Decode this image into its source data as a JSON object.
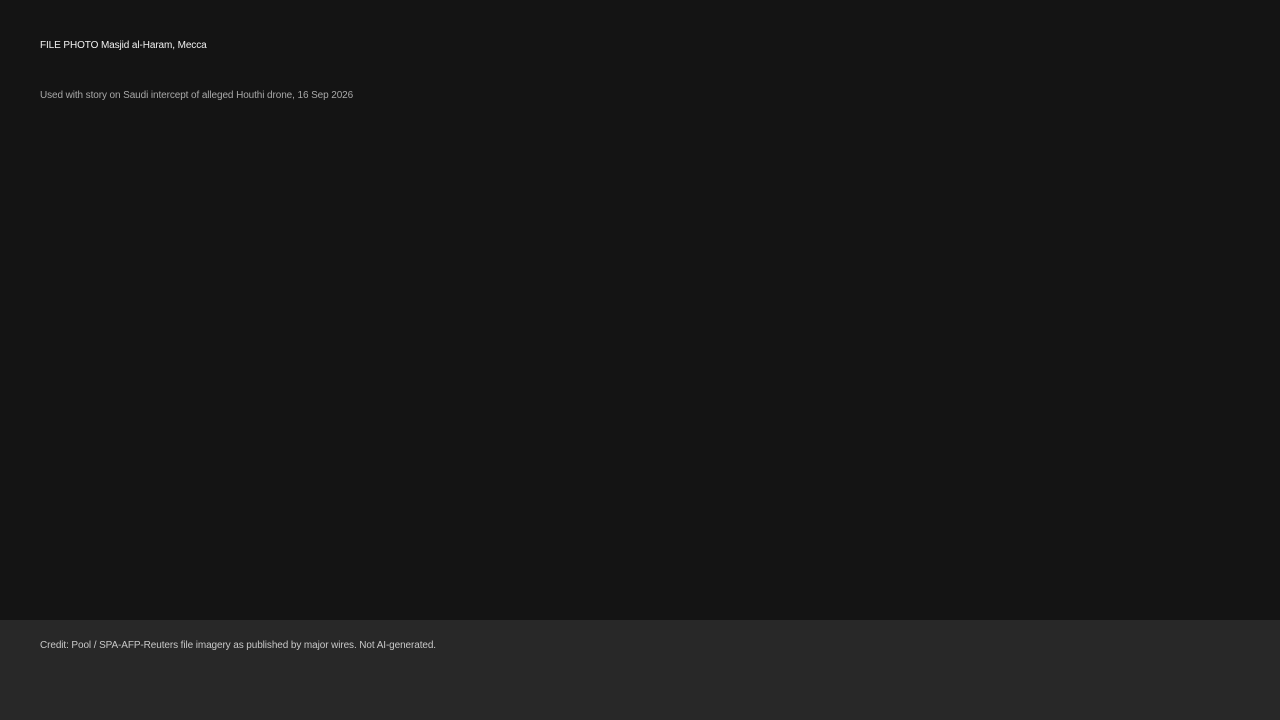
{
  "photo": {
    "title": "FILE PHOTO  Masjid al-Haram, Mecca",
    "caption": "Used with story on Saudi intercept of alleged Houthi drone, 16 Sep 2026"
  },
  "footer": {
    "credit": "Credit: Pool / SPA-AFP-Reuters file imagery as published by major wires. Not AI-generated."
  },
  "colors": {
    "background": "#141414",
    "credit_bar": "#282828"
  }
}
